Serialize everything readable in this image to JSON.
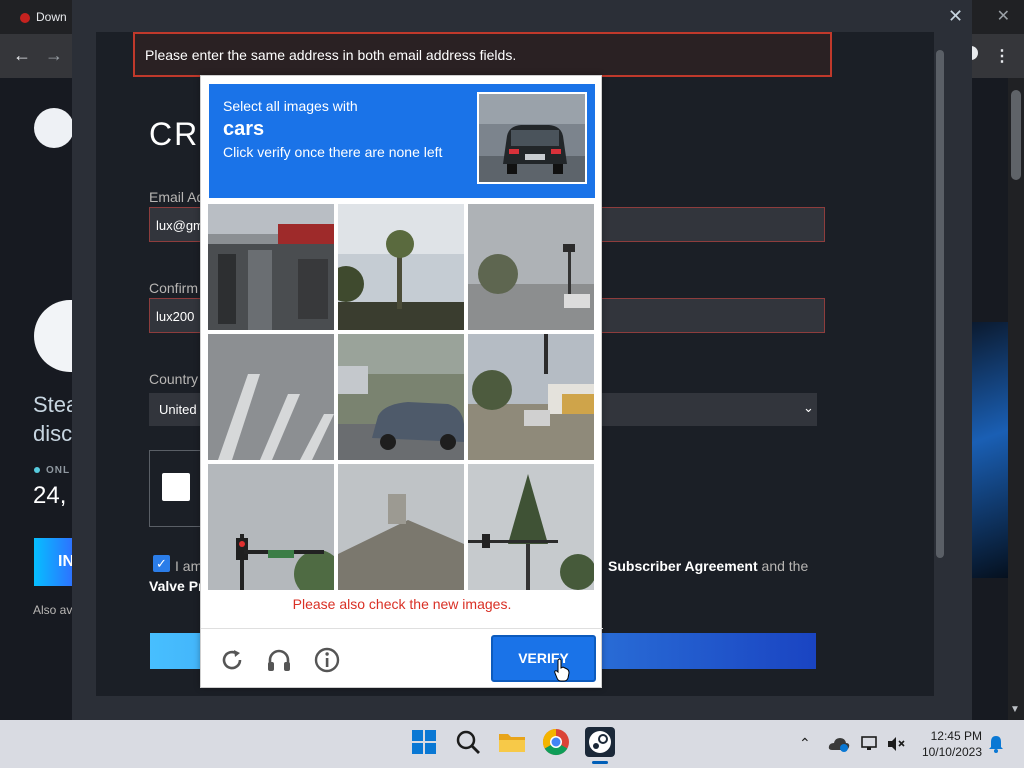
{
  "browser": {
    "tab_title": "Down",
    "close_glyph": "✕",
    "back_glyph": "←",
    "forward_glyph": "→",
    "menu_glyph": "⋮"
  },
  "steam_page": {
    "heading_partial": "CRE",
    "side_line1": "Stea",
    "side_line2": "discu",
    "online_label": "ONL",
    "online_count": "24,",
    "install_label": "IN",
    "also_text": "Also av"
  },
  "modal": {
    "close_glyph": "✕",
    "error_text": "Please enter the same address in both email address fields.",
    "email_label": "Email Ad",
    "email_value": "lux@gm",
    "confirm_label": "Confirm",
    "confirm_value": "lux200",
    "country_label": "Country",
    "country_value": "United",
    "agree_prefix": "I am",
    "agree_middle_bold": "Subscriber Agreement",
    "agree_suffix": " and the",
    "agree_line2": "Valve Pr"
  },
  "recaptcha": {
    "instruction_line1": "Select all images with",
    "target_object": "cars",
    "instruction_line2": "Click verify once there are none left",
    "error_message": "Please also check the new images.",
    "verify_label": "VERIFY",
    "icons": [
      "reload-icon",
      "audio-challenge-icon",
      "info-icon"
    ]
  },
  "taskbar": {
    "time": "12:45 PM",
    "date": "10/10/2023",
    "apps": [
      "start-icon",
      "search-icon",
      "file-explorer-icon",
      "chrome-icon",
      "steam-icon"
    ],
    "tray": [
      "chevron-up-icon",
      "onedrive-icon",
      "network-icon",
      "volume-icon",
      "notification-bell-icon"
    ]
  },
  "colors": {
    "recaptcha_blue": "#1a73e8",
    "error_red": "#d93025",
    "steam_bg": "#171a21"
  }
}
